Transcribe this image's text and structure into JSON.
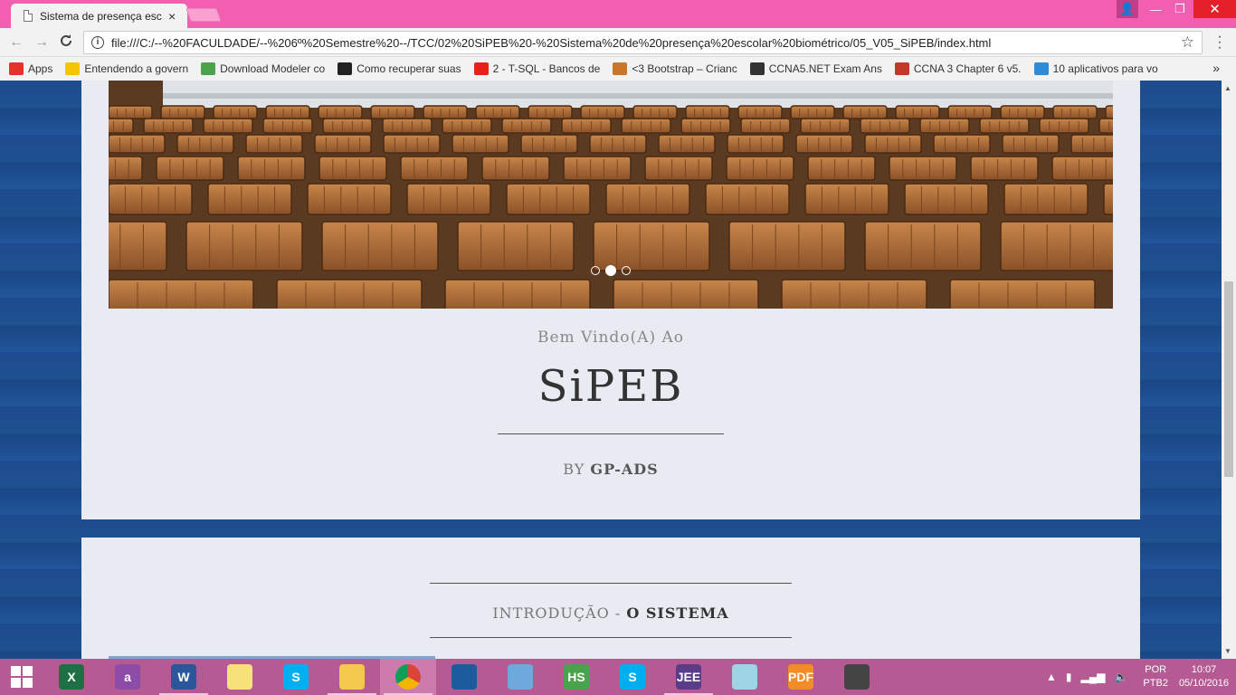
{
  "browser": {
    "tab_title": "Sistema de presença esc",
    "tab_close": "×",
    "url": "file:///C:/--%20FACULDADE/--%206º%20Semestre%20--/TCC/02%20SiPEB%20-%20Sistema%20de%20presença%20escolar%20biométrico/05_V05_SiPEB/index.html",
    "window_controls": {
      "user": "👤",
      "minimize": "—",
      "maximize": "❐",
      "close": "✕"
    },
    "nav": {
      "back": "←",
      "forward": "→",
      "reload": "C"
    }
  },
  "bookmarks": [
    {
      "label": "Apps",
      "icon": "apps-grid-icon",
      "color": "#e4312b"
    },
    {
      "label": "Entendendo a govern",
      "icon": "tcu-icon",
      "color": "#f5c400"
    },
    {
      "label": "Download Modeler co",
      "icon": "modeler-cube-icon",
      "color": "#4aa34a"
    },
    {
      "label": "Como recuperar suas",
      "icon": "github-icon",
      "color": "#222222"
    },
    {
      "label": "2 - T-SQL - Bancos de",
      "icon": "youtube-icon",
      "color": "#e62117"
    },
    {
      "label": "<3 Bootstrap – Crianc",
      "icon": "lion-icon",
      "color": "#c9752a"
    },
    {
      "label": "CCNA5.NET Exam Ans",
      "icon": "paper-plane-icon",
      "color": "#333333"
    },
    {
      "label": "CCNA 3 Chapter 6 v5.",
      "icon": "cisco-icon",
      "color": "#c0392b"
    },
    {
      "label": "10 aplicativos para vo",
      "icon": "blocks-icon",
      "color": "#2e8bd6"
    }
  ],
  "bookmarks_more": "»",
  "hero": {
    "welcome": "Bem Vindo(A) Ao",
    "brand": "SiPEB",
    "by_prefix": "BY",
    "by_name": "GP-ADS",
    "slides_total": 3,
    "slide_active": 2
  },
  "intro": {
    "prefix": "INTRODUÇÃO -",
    "title": "O SISTEMA"
  },
  "taskbar": {
    "apps": [
      {
        "name": "excel",
        "label": "X",
        "color": "#1d7044",
        "running": false
      },
      {
        "name": "azure",
        "label": "a",
        "color": "#8c4ca8",
        "running": false
      },
      {
        "name": "word",
        "label": "W",
        "color": "#2b579a",
        "running": true
      },
      {
        "name": "sticky",
        "label": "",
        "color": "#f7e27a",
        "running": false
      },
      {
        "name": "skype",
        "label": "S",
        "color": "#00aff0",
        "running": false
      },
      {
        "name": "explorer",
        "label": "",
        "color": "#f2c94c",
        "running": true
      },
      {
        "name": "chrome",
        "label": "",
        "color": "#db4437",
        "running": true,
        "active": true
      },
      {
        "name": "virtualbox",
        "label": "",
        "color": "#1c5c9e",
        "running": false
      },
      {
        "name": "3d-box",
        "label": "",
        "color": "#6fa8dc",
        "running": false
      },
      {
        "name": "hs",
        "label": "HS",
        "color": "#4aa34a",
        "running": false
      },
      {
        "name": "skype2",
        "label": "S",
        "color": "#00aff0",
        "running": false
      },
      {
        "name": "java-ee",
        "label": "JEE",
        "color": "#5a3c8a",
        "running": true
      },
      {
        "name": "notes",
        "label": "",
        "color": "#9fd4e6",
        "running": false
      },
      {
        "name": "pdf",
        "label": "PDF",
        "color": "#f28c28",
        "running": false
      },
      {
        "name": "sync",
        "label": "",
        "color": "#444444",
        "running": false
      }
    ],
    "lang_top": "POR",
    "lang_bottom": "PTB2",
    "time": "10:07",
    "date": "05/10/2016"
  }
}
